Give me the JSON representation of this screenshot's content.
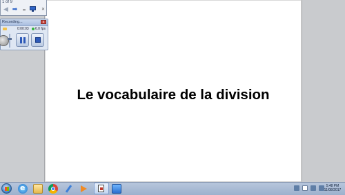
{
  "slide": {
    "title": "Le vocabulaire de la division"
  },
  "presentation_nav": {
    "page_count": "1 of 9",
    "prev_label": "◀",
    "next_label": "➡",
    "more_label": "...",
    "close_label": "✕"
  },
  "recorder": {
    "title": "Recording...",
    "close_label": "x",
    "elapsed": "0:00:03",
    "fps": "6.0 fps",
    "status_color": "#33b33c"
  },
  "taskbar": {
    "clock_time": "5:48 PM",
    "clock_date": "11/08/2017",
    "pinned_icons": [
      "start-orb",
      "internet-explorer-icon",
      "folder-icon",
      "chrome-icon",
      "pen-icon",
      "media-player-icon",
      "presentation-app-icon",
      "recorder-app-icon"
    ]
  }
}
